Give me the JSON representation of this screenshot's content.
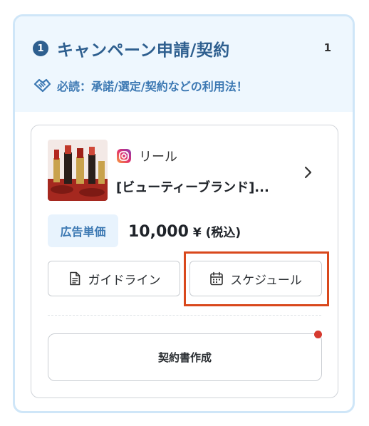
{
  "campaign_panel": {
    "step_number": "1",
    "title": "キャンペーン申請/契約",
    "count": "1",
    "guide_link": {
      "icon": "handshake-icon",
      "label": "必読：承諾/選定/契約などの利用法！"
    }
  },
  "campaign_card": {
    "thumbnail": {
      "icon": "lipstick-product-image"
    },
    "media": {
      "icon": "instagram-icon",
      "label": "リール"
    },
    "name": "[ビューティーブランド]...",
    "price": {
      "badge": "広告単価",
      "value": "10,000",
      "suffix": " ¥ (税込)"
    },
    "buttons": {
      "guideline": {
        "icon": "document-icon",
        "label": "ガイドライン"
      },
      "schedule": {
        "icon": "calendar-icon",
        "label": "スケジュール"
      },
      "contract": {
        "label": "契約書作成"
      }
    }
  },
  "colors": {
    "accent_dark": "#2e5f8f",
    "accent": "#3d79b3",
    "header_bg": "#eef7fe",
    "panel_border": "#cfe6f8",
    "highlight": "#d9481c",
    "notify_dot": "#d63a2f"
  }
}
